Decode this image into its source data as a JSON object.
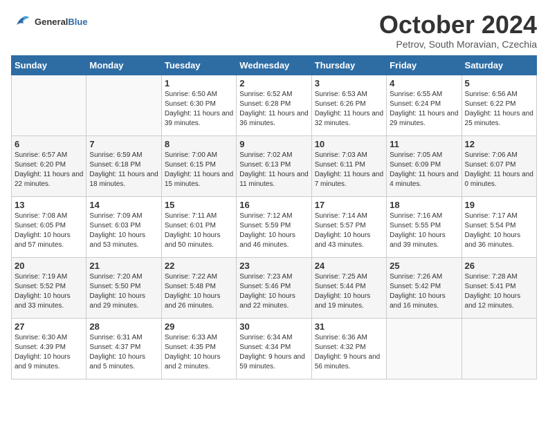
{
  "header": {
    "logo_general": "General",
    "logo_blue": "Blue",
    "month_title": "October 2024",
    "location": "Petrov, South Moravian, Czechia"
  },
  "weekdays": [
    "Sunday",
    "Monday",
    "Tuesday",
    "Wednesday",
    "Thursday",
    "Friday",
    "Saturday"
  ],
  "weeks": [
    [
      {
        "day": "",
        "detail": ""
      },
      {
        "day": "",
        "detail": ""
      },
      {
        "day": "1",
        "detail": "Sunrise: 6:50 AM\nSunset: 6:30 PM\nDaylight: 11 hours and 39 minutes."
      },
      {
        "day": "2",
        "detail": "Sunrise: 6:52 AM\nSunset: 6:28 PM\nDaylight: 11 hours and 36 minutes."
      },
      {
        "day": "3",
        "detail": "Sunrise: 6:53 AM\nSunset: 6:26 PM\nDaylight: 11 hours and 32 minutes."
      },
      {
        "day": "4",
        "detail": "Sunrise: 6:55 AM\nSunset: 6:24 PM\nDaylight: 11 hours and 29 minutes."
      },
      {
        "day": "5",
        "detail": "Sunrise: 6:56 AM\nSunset: 6:22 PM\nDaylight: 11 hours and 25 minutes."
      }
    ],
    [
      {
        "day": "6",
        "detail": "Sunrise: 6:57 AM\nSunset: 6:20 PM\nDaylight: 11 hours and 22 minutes."
      },
      {
        "day": "7",
        "detail": "Sunrise: 6:59 AM\nSunset: 6:18 PM\nDaylight: 11 hours and 18 minutes."
      },
      {
        "day": "8",
        "detail": "Sunrise: 7:00 AM\nSunset: 6:15 PM\nDaylight: 11 hours and 15 minutes."
      },
      {
        "day": "9",
        "detail": "Sunrise: 7:02 AM\nSunset: 6:13 PM\nDaylight: 11 hours and 11 minutes."
      },
      {
        "day": "10",
        "detail": "Sunrise: 7:03 AM\nSunset: 6:11 PM\nDaylight: 11 hours and 7 minutes."
      },
      {
        "day": "11",
        "detail": "Sunrise: 7:05 AM\nSunset: 6:09 PM\nDaylight: 11 hours and 4 minutes."
      },
      {
        "day": "12",
        "detail": "Sunrise: 7:06 AM\nSunset: 6:07 PM\nDaylight: 11 hours and 0 minutes."
      }
    ],
    [
      {
        "day": "13",
        "detail": "Sunrise: 7:08 AM\nSunset: 6:05 PM\nDaylight: 10 hours and 57 minutes."
      },
      {
        "day": "14",
        "detail": "Sunrise: 7:09 AM\nSunset: 6:03 PM\nDaylight: 10 hours and 53 minutes."
      },
      {
        "day": "15",
        "detail": "Sunrise: 7:11 AM\nSunset: 6:01 PM\nDaylight: 10 hours and 50 minutes."
      },
      {
        "day": "16",
        "detail": "Sunrise: 7:12 AM\nSunset: 5:59 PM\nDaylight: 10 hours and 46 minutes."
      },
      {
        "day": "17",
        "detail": "Sunrise: 7:14 AM\nSunset: 5:57 PM\nDaylight: 10 hours and 43 minutes."
      },
      {
        "day": "18",
        "detail": "Sunrise: 7:16 AM\nSunset: 5:55 PM\nDaylight: 10 hours and 39 minutes."
      },
      {
        "day": "19",
        "detail": "Sunrise: 7:17 AM\nSunset: 5:54 PM\nDaylight: 10 hours and 36 minutes."
      }
    ],
    [
      {
        "day": "20",
        "detail": "Sunrise: 7:19 AM\nSunset: 5:52 PM\nDaylight: 10 hours and 33 minutes."
      },
      {
        "day": "21",
        "detail": "Sunrise: 7:20 AM\nSunset: 5:50 PM\nDaylight: 10 hours and 29 minutes."
      },
      {
        "day": "22",
        "detail": "Sunrise: 7:22 AM\nSunset: 5:48 PM\nDaylight: 10 hours and 26 minutes."
      },
      {
        "day": "23",
        "detail": "Sunrise: 7:23 AM\nSunset: 5:46 PM\nDaylight: 10 hours and 22 minutes."
      },
      {
        "day": "24",
        "detail": "Sunrise: 7:25 AM\nSunset: 5:44 PM\nDaylight: 10 hours and 19 minutes."
      },
      {
        "day": "25",
        "detail": "Sunrise: 7:26 AM\nSunset: 5:42 PM\nDaylight: 10 hours and 16 minutes."
      },
      {
        "day": "26",
        "detail": "Sunrise: 7:28 AM\nSunset: 5:41 PM\nDaylight: 10 hours and 12 minutes."
      }
    ],
    [
      {
        "day": "27",
        "detail": "Sunrise: 6:30 AM\nSunset: 4:39 PM\nDaylight: 10 hours and 9 minutes."
      },
      {
        "day": "28",
        "detail": "Sunrise: 6:31 AM\nSunset: 4:37 PM\nDaylight: 10 hours and 5 minutes."
      },
      {
        "day": "29",
        "detail": "Sunrise: 6:33 AM\nSunset: 4:35 PM\nDaylight: 10 hours and 2 minutes."
      },
      {
        "day": "30",
        "detail": "Sunrise: 6:34 AM\nSunset: 4:34 PM\nDaylight: 9 hours and 59 minutes."
      },
      {
        "day": "31",
        "detail": "Sunrise: 6:36 AM\nSunset: 4:32 PM\nDaylight: 9 hours and 56 minutes."
      },
      {
        "day": "",
        "detail": ""
      },
      {
        "day": "",
        "detail": ""
      }
    ]
  ]
}
